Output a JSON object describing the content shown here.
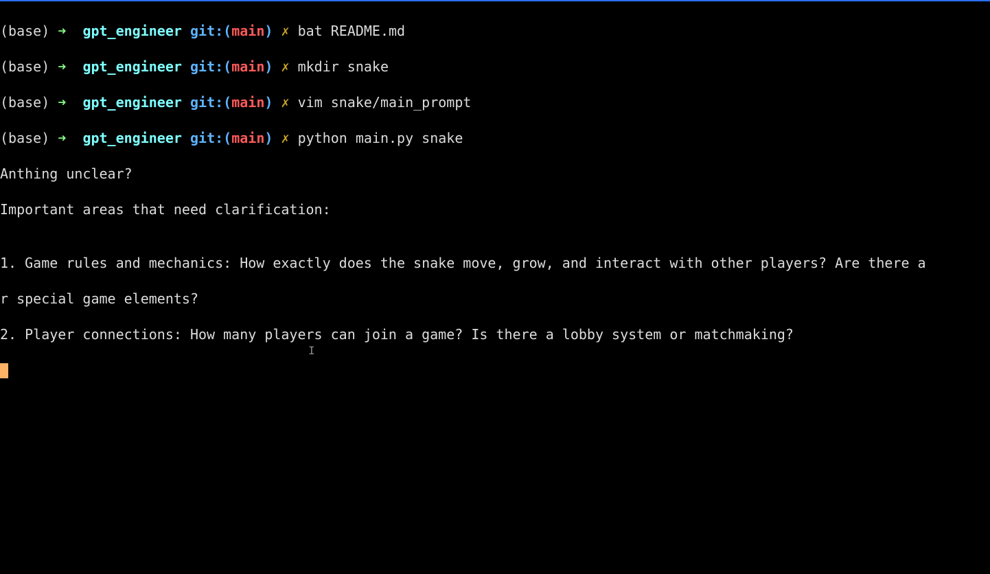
{
  "prompt": {
    "env": "(base)",
    "arrow": "➜",
    "dir": "gpt_engineer",
    "git_label": "git:(",
    "branch": "main",
    "git_close": ")",
    "cross": "✗"
  },
  "history": [
    {
      "cmd": "bat README.md"
    },
    {
      "cmd": "mkdir snake"
    },
    {
      "cmd": "vim snake/main_prompt"
    },
    {
      "cmd": "python main.py snake"
    }
  ],
  "output": {
    "l1": "Anthing unclear?",
    "l2": "Important areas that need clarification:",
    "l3": "",
    "l4": "1. Game rules and mechanics: How exactly does the snake move, grow, and interact with other players? Are there a",
    "l5": "r special game elements?",
    "l6": "2. Player connections: How many players can join a game? Is there a lobby system or matchmaking?"
  },
  "ibeam": "I"
}
